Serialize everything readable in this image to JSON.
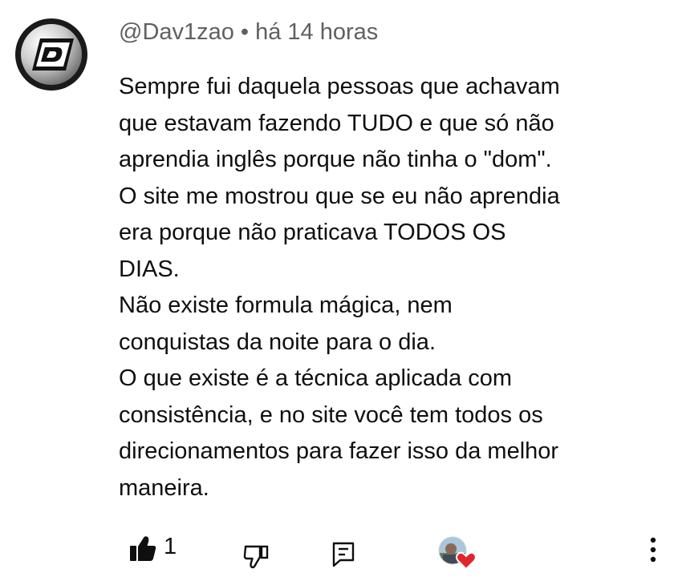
{
  "comment": {
    "author": "@Dav1zao",
    "separator": "•",
    "timestamp": "há 14 horas",
    "lines": [
      "Sempre fui daquela pessoas que achavam",
      "que estavam fazendo TUDO e que só não",
      "aprendia inglês porque não tinha o \"dom\".",
      "O site me mostrou que se eu não aprendia",
      "era porque não praticava TODOS OS",
      "DIAS.",
      "Não existe formula mágica, nem",
      "conquistas da noite para o dia.",
      "O que existe é a técnica aplicada com",
      "consistência, e no site você tem todos os",
      "direcionamentos para fazer isso da melhor",
      "maneira."
    ]
  },
  "actions": {
    "like_count": "1",
    "icons": {
      "like": "thumbs-up-icon",
      "dislike": "thumbs-down-icon",
      "reply": "reply-icon",
      "creator_heart": "creator-heart-badge",
      "more": "more-vertical-icon"
    }
  },
  "colors": {
    "text": "#0f0f0f",
    "meta": "#606060",
    "heart": "#e0262c"
  }
}
